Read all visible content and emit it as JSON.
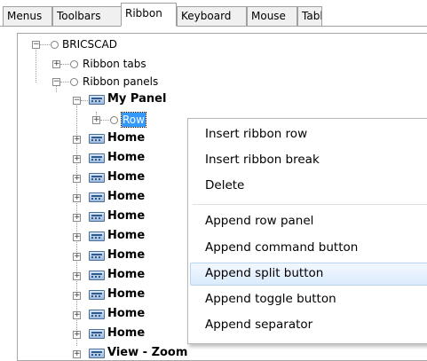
{
  "tabs": [
    {
      "label": "Menus",
      "active": false
    },
    {
      "label": "Toolbars",
      "active": false
    },
    {
      "label": "Ribbon",
      "active": true
    },
    {
      "label": "Keyboard",
      "active": false
    },
    {
      "label": "Mouse",
      "active": false
    },
    {
      "label": "Table",
      "active": false
    }
  ],
  "tree": {
    "root": "BRICSCAD",
    "ribbon_tabs": "Ribbon tabs",
    "ribbon_panels": "Ribbon panels",
    "my_panel": "My Panel",
    "row": "Row",
    "home_items": [
      "Home",
      "Home",
      "Home",
      "Home",
      "Home",
      "Home",
      "Home",
      "Home",
      "Home",
      "Home",
      "Home"
    ],
    "view_zoom": "View - Zoom"
  },
  "context_menu": {
    "items": [
      "Insert ribbon row",
      "Insert ribbon break",
      "Delete",
      "Append row panel",
      "Append command button",
      "Append split button",
      "Append toggle button",
      "Append separator"
    ],
    "hovered": "Append split button"
  },
  "colors": {
    "selection": "#3399ff",
    "menu_hover": "#dbebfc",
    "panel_icon": "#9fbadb"
  },
  "icons": {
    "expand": "plus-box-icon",
    "collapse": "minus-box-icon",
    "node": "circle-node-icon",
    "panel": "ribbon-panel-icon"
  }
}
